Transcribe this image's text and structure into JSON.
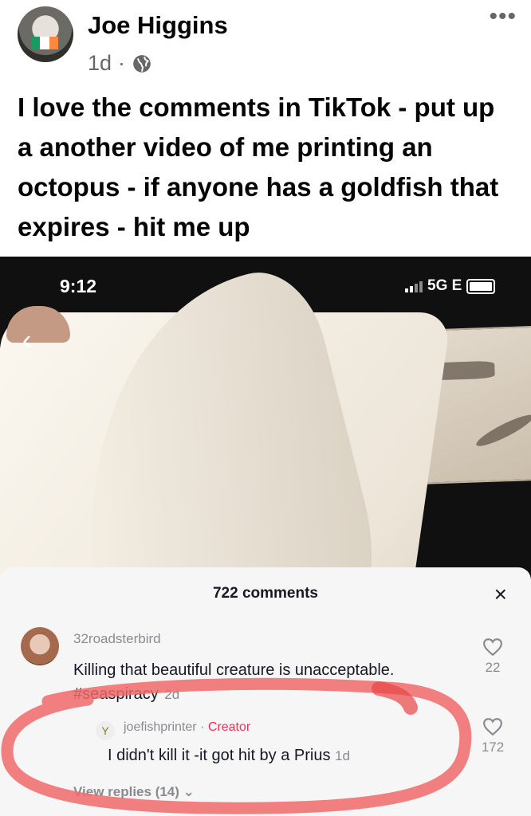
{
  "post": {
    "author": "Joe Higgins",
    "time": "1d",
    "separator": "·",
    "more_icon": "more-horizontal-icon",
    "visibility_icon": "globe-icon",
    "text": "I love the comments in TikTok - put up a another video of me printing an octopus - if anyone has a goldfish that expires - hit me up"
  },
  "screenshot": {
    "status_time": "9:12",
    "network": "5G E",
    "comments_count": "722 comments",
    "close_label": "×",
    "back_label": "‹",
    "comments": [
      {
        "username": "32roadsterbird",
        "text": "Killing that beautiful creature is unacceptable.",
        "hashtag": "#seaspiracy",
        "time": "2d",
        "likes": "22"
      },
      {
        "username": "joefishprinter",
        "badge_separator": "·",
        "badge": "Creator",
        "text": "I didn't kill it -it got hit by a Prius",
        "time": "1d",
        "likes": "172"
      }
    ],
    "view_replies": "View replies (14)"
  },
  "colors": {
    "text_primary": "#050505",
    "text_secondary": "#65676b",
    "tiktok_creator": "#fe2c55",
    "highlight": "#f06a6a"
  }
}
